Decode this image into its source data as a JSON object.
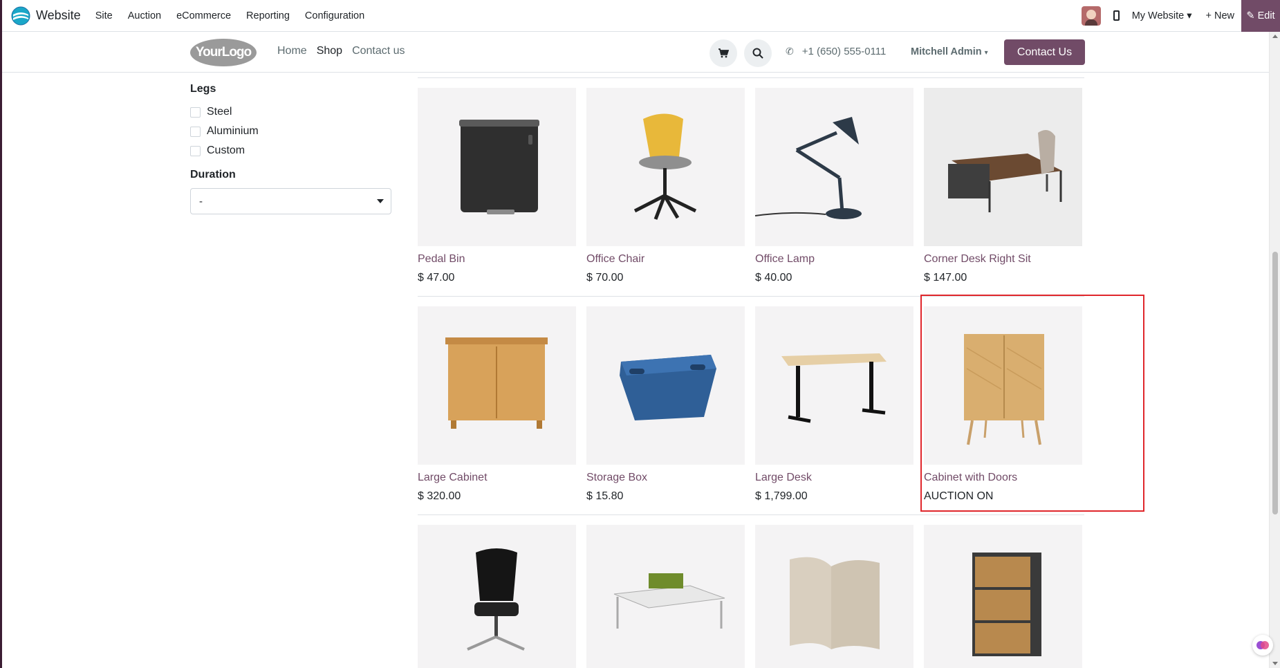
{
  "topbar": {
    "app_name": "Website",
    "menu": [
      "Site",
      "Auction",
      "eCommerce",
      "Reporting",
      "Configuration"
    ],
    "website_selector": "My Website ▾",
    "new_label": "+ New",
    "edit_label": "✎ Edit"
  },
  "header": {
    "logo_text": "YourLogo",
    "nav": [
      "Home",
      "Shop",
      "Contact us"
    ],
    "phone": "+1 (650) 555-0111",
    "user": "Mitchell Admin",
    "contact_button": "Contact Us"
  },
  "sidebar": {
    "legs_title": "Legs",
    "legs_options": [
      "Steel",
      "Aluminium",
      "Custom"
    ],
    "duration_title": "Duration",
    "duration_value": "-"
  },
  "products": [
    {
      "name": "Pedal Bin",
      "price": "$ 47.00"
    },
    {
      "name": "Office Chair",
      "price": "$ 70.00"
    },
    {
      "name": "Office Lamp",
      "price": "$ 40.00"
    },
    {
      "name": "Corner Desk Right Sit",
      "price": "$ 147.00"
    },
    {
      "name": "Large Cabinet",
      "price": "$ 320.00"
    },
    {
      "name": "Storage Box",
      "price": "$ 15.80"
    },
    {
      "name": "Large Desk",
      "price": "$ 1,799.00"
    },
    {
      "name": "Cabinet with Doors",
      "price": "AUCTION ON"
    }
  ],
  "colors": {
    "brand": "#714b67",
    "highlight": "#e0262b"
  }
}
